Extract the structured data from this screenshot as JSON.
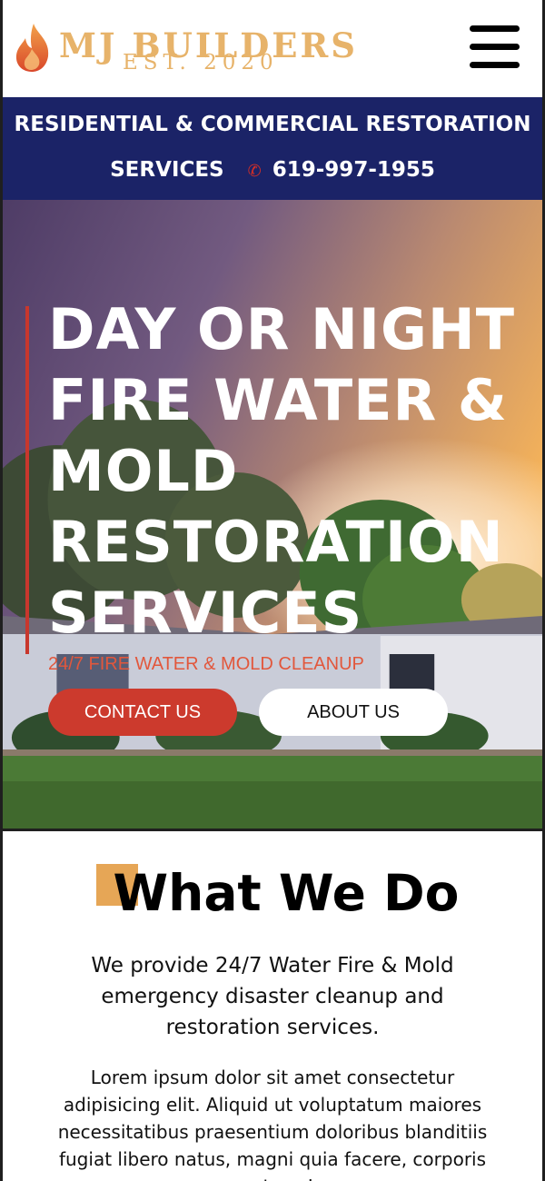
{
  "header": {
    "brand_name": "MJ BUILDERS",
    "brand_est": "EST. 2020",
    "logo_icon": "flame-icon",
    "menu_icon": "hamburger-menu-icon"
  },
  "banner": {
    "line1": "RESIDENTIAL & COMMERCIAL RESTORATION",
    "services_label": "SERVICES",
    "phone_icon": "phone-icon",
    "phone": "619-997-1955"
  },
  "hero": {
    "title_lines": [
      "DAY OR NIGHT",
      "FIRE WATER &",
      "MOLD",
      "RESTORATION",
      "SERVICES"
    ],
    "subtitle": "24/7 FIRE WATER & MOLD CLEANUP",
    "contact_button": "CONTACT US",
    "about_button": "ABOUT US"
  },
  "what_we_do": {
    "title": "What We Do",
    "lead": "We provide 24/7 Water Fire & Mold emergency disaster cleanup and restoration services.",
    "body": "Lorem ipsum dolor sit amet consectetur adipisicing elit. Aliquid ut voluptatum maiores necessitatibus praesentium doloribus blanditiis fugiat libero natus, magni quia facere, corporis nostrum!"
  },
  "colors": {
    "brand_gold": "#e7b36a",
    "banner_blue": "#1b2367",
    "accent_red": "#cc3a2d",
    "accent_orange": "#e6a656"
  }
}
